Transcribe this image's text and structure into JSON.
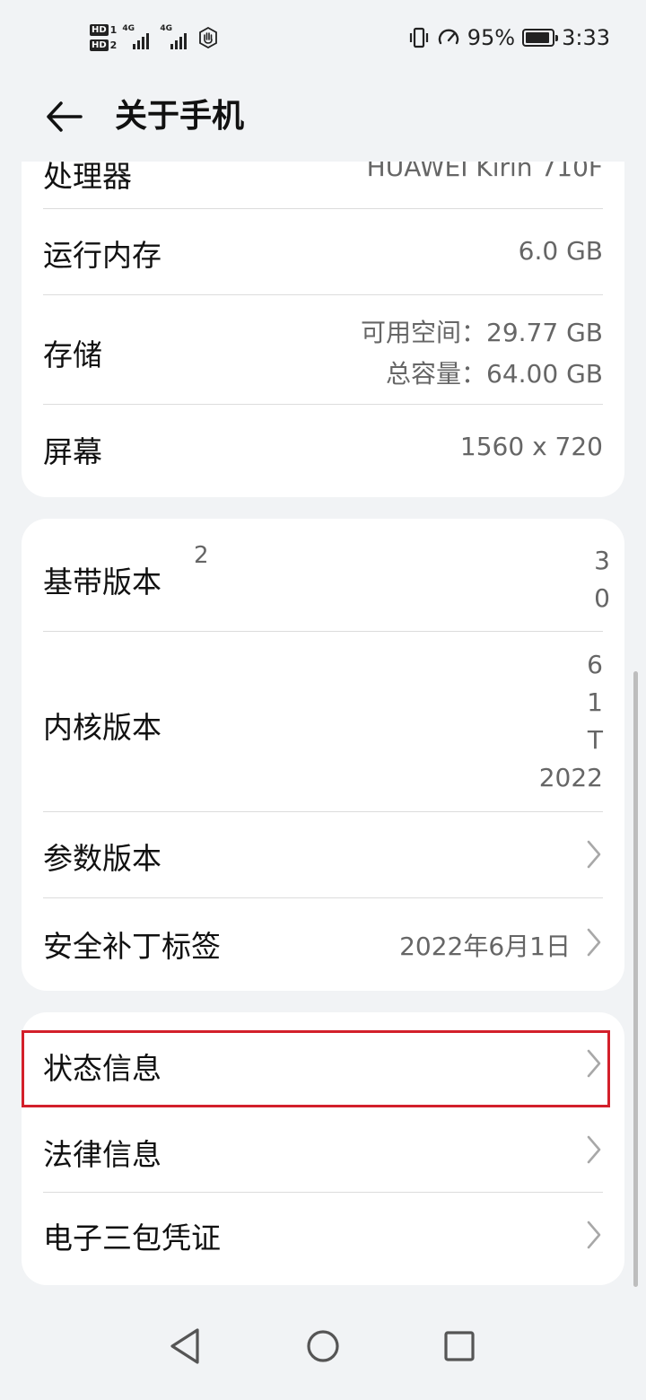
{
  "status_bar": {
    "sim1": "HD",
    "sim1_num": "1",
    "sim2": "HD",
    "sim2_num": "2",
    "net1": "4G",
    "net2": "4G",
    "battery_percent": "95%",
    "time": "3:33",
    "icons": [
      "vibrate-icon",
      "speed-icon",
      "battery-icon",
      "hand-icon"
    ]
  },
  "header": {
    "title": "关于手机"
  },
  "card1": {
    "processor": {
      "label": "处理器",
      "value": "HUAWEI Kirin 710F"
    },
    "ram": {
      "label": "运行内存",
      "value": "6.0 GB"
    },
    "storage": {
      "label": "存储",
      "available": "可用空间：29.77  GB",
      "total": "总容量：64.00  GB"
    },
    "screen": {
      "label": "屏幕",
      "value": "1560 x 720"
    }
  },
  "card2": {
    "baseband": {
      "label": "基带版本",
      "frag_left": "2",
      "frag_right1": "3",
      "frag_right2": "0"
    },
    "kernel": {
      "label": "内核版本",
      "lines": [
        "6",
        "1",
        "T",
        "2022"
      ]
    },
    "params": {
      "label": "参数版本"
    },
    "patch": {
      "label": "安全补丁标签",
      "value": "2022年6月1日"
    }
  },
  "card3": {
    "status": {
      "label": "状态信息"
    },
    "legal": {
      "label": "法律信息"
    },
    "warranty": {
      "label": "电子三包凭证"
    }
  },
  "colors": {
    "highlight": "#d3202b",
    "background": "#f1f3f5"
  }
}
